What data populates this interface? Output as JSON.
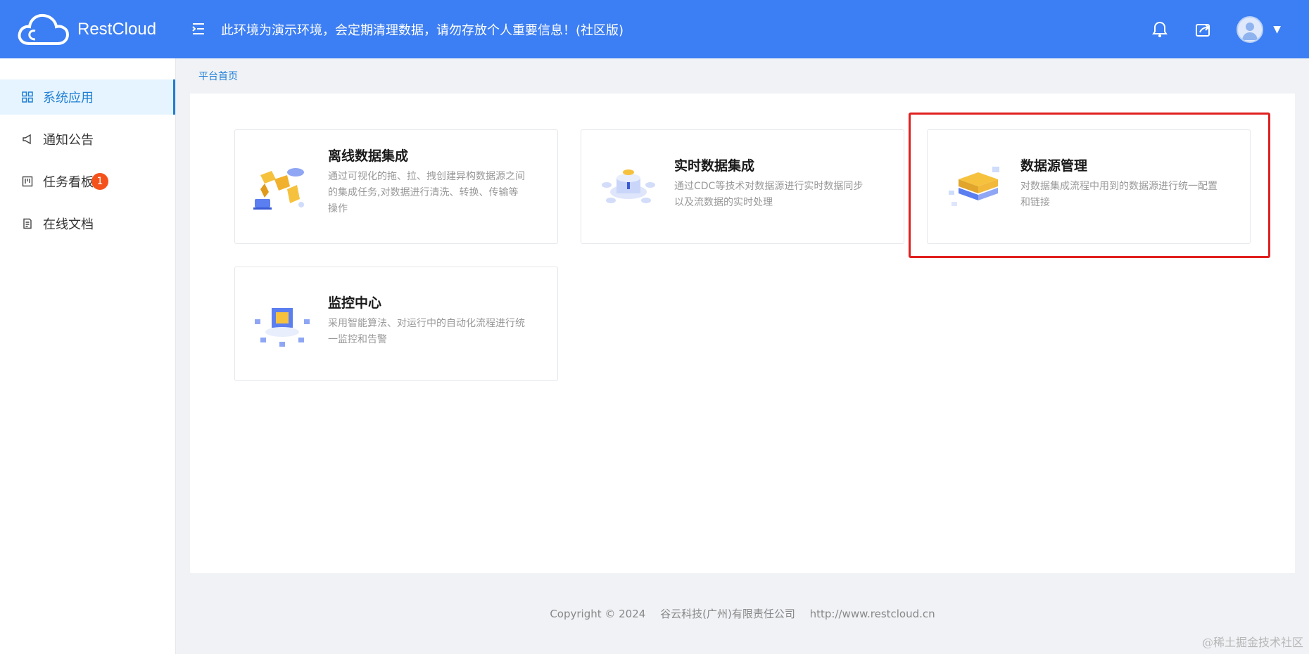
{
  "header": {
    "logo_text": "RestCloud",
    "notice": "此环境为演示环境，会定期清理数据，请勿存放个人重要信息！(社区版)"
  },
  "sidebar": {
    "items": [
      {
        "label": "系统应用",
        "icon": "grid-icon",
        "active": true
      },
      {
        "label": "通知公告",
        "icon": "megaphone-icon"
      },
      {
        "label": "任务看板",
        "icon": "kanban-icon",
        "badge": "1"
      },
      {
        "label": "在线文档",
        "icon": "document-icon"
      }
    ]
  },
  "breadcrumb": {
    "home": "平台首页"
  },
  "cards": [
    {
      "title": "离线数据集成",
      "desc": "通过可视化的拖、拉、拽创建异构数据源之间的集成任务,对数据进行清洗、转换、传输等操作"
    },
    {
      "title": "实时数据集成",
      "desc": "通过CDC等技术对数据源进行实时数据同步以及流数据的实时处理"
    },
    {
      "title": "数据源管理",
      "desc": "对数据集成流程中用到的数据源进行统一配置和链接"
    },
    {
      "title": "监控中心",
      "desc": "采用智能算法、对运行中的自动化流程进行统一监控和告警"
    }
  ],
  "footer": {
    "copyright": "Copyright © 2024",
    "company": "谷云科技(广州)有限责任公司",
    "url": "http://www.restcloud.cn"
  },
  "watermark": "@稀土掘金技术社区",
  "colors": {
    "header": "#3c7ef3",
    "active": "#1f7fd6",
    "badge": "#f5521b",
    "highlight": "#e02020"
  }
}
